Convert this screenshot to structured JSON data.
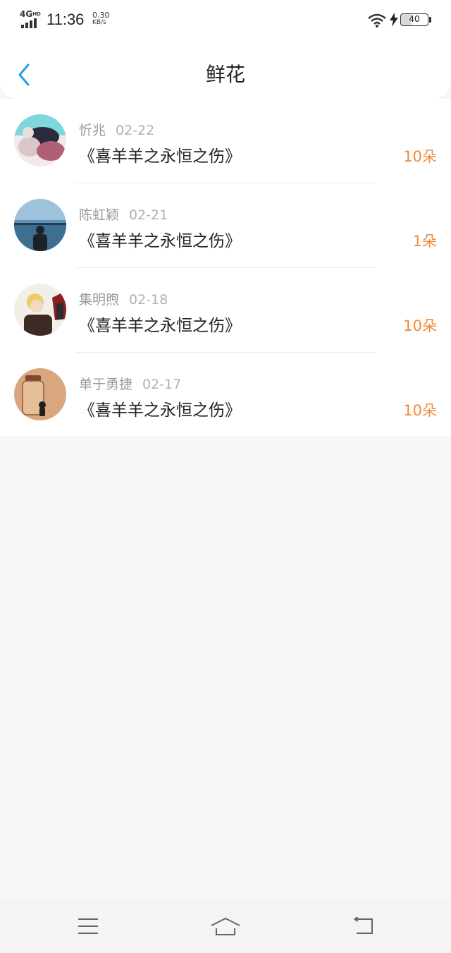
{
  "status_bar": {
    "network": "4G",
    "network_sup": "HD",
    "time": "11:36",
    "speed_value": "0.30",
    "speed_unit": "KB/s",
    "battery": "40",
    "icons": [
      "signal-icon",
      "wifi-icon",
      "charging-icon",
      "battery-icon"
    ]
  },
  "header": {
    "title": "鲜花",
    "back_icon": "chevron-left-icon"
  },
  "colors": {
    "accent": "#2b9be8",
    "count": "#f08a3c",
    "meta": "#9a9a9a"
  },
  "gifts": [
    {
      "name": "忻兆",
      "date": "02-22",
      "book": "《喜羊羊之永恒之伤》",
      "count": "10朵"
    },
    {
      "name": "陈虹颖",
      "date": "02-21",
      "book": "《喜羊羊之永恒之伤》",
      "count": "1朵"
    },
    {
      "name": "集明煦",
      "date": "02-18",
      "book": "《喜羊羊之永恒之伤》",
      "count": "10朵"
    },
    {
      "name": "单于勇捷",
      "date": "02-17",
      "book": "《喜羊羊之永恒之伤》",
      "count": "10朵"
    }
  ],
  "nav_bar": {
    "icons": [
      "menu-icon",
      "home-icon",
      "back-icon"
    ]
  }
}
